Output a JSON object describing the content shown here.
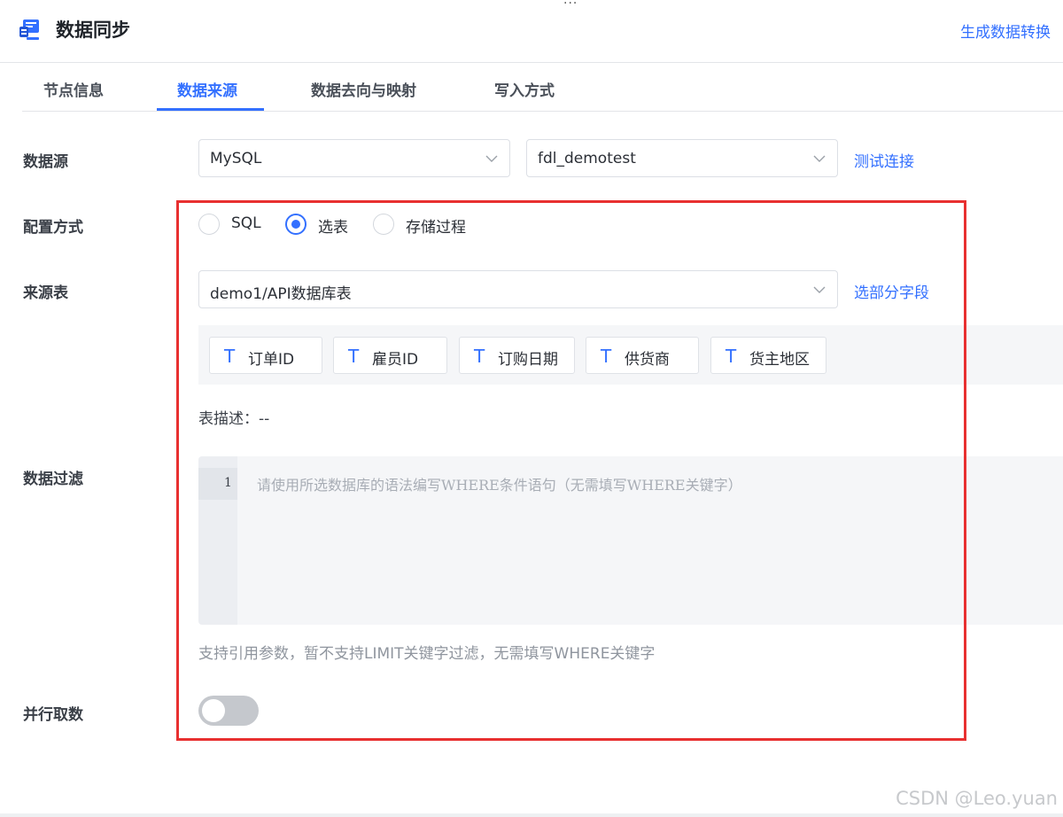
{
  "window": {
    "menu_dots": "···"
  },
  "header": {
    "title": "数据同步",
    "action_link": "生成数据转换"
  },
  "tabs": [
    {
      "label": "节点信息",
      "active": false
    },
    {
      "label": "数据来源",
      "active": true
    },
    {
      "label": "数据去向与映射",
      "active": false
    },
    {
      "label": "写入方式",
      "active": false
    }
  ],
  "form": {
    "datasource": {
      "label": "数据源",
      "type_value": "MySQL",
      "connection_value": "fdl_demotest",
      "test_link": "测试连接"
    },
    "config_mode": {
      "label": "配置方式",
      "options": [
        {
          "label": "SQL",
          "checked": false
        },
        {
          "label": "选表",
          "checked": true
        },
        {
          "label": "存储过程",
          "checked": false
        }
      ]
    },
    "source_table": {
      "label": "来源表",
      "value": "demo1/API数据库表",
      "select_fields_link": "选部分字段",
      "fields": [
        "订单ID",
        "雇员ID",
        "订购日期",
        "供货商",
        "货主地区"
      ],
      "field_type_glyph": "T",
      "description": "表描述：--"
    },
    "data_filter": {
      "label": "数据过滤",
      "line_number": "1",
      "placeholder": "请使用所选数据库的语法编写WHERE条件语句（无需填写WHERE关键字）",
      "hint": "支持引用参数，暂不支持LIMIT关键字过滤，无需填写WHERE关键字"
    },
    "parallel": {
      "label": "并行取数",
      "enabled": false
    }
  },
  "watermark": "CSDN @Leo.yuan",
  "colors": {
    "accent": "#3370ff",
    "highlight_border": "#e83030"
  },
  "icons": {
    "header": "data-sync-icon",
    "select_chevron": "chevron-down-icon",
    "field_type": "text-type-icon"
  }
}
